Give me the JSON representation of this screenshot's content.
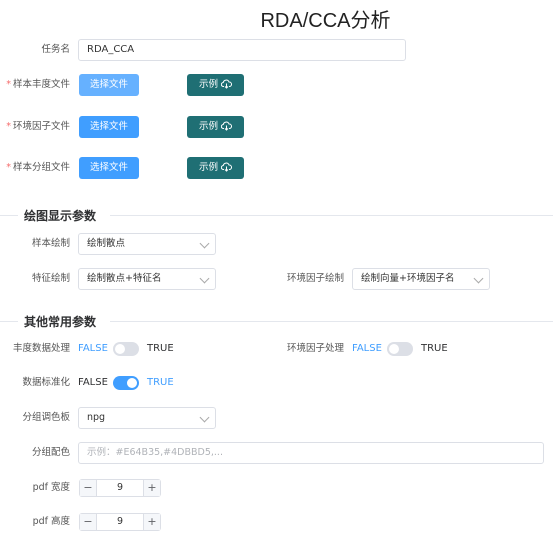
{
  "page": {
    "title": "RDA/CCA分析"
  },
  "task": {
    "label": "任务名",
    "value": "RDA_CCA"
  },
  "files": [
    {
      "label": "样本丰度文件",
      "button": "选择文件",
      "example": "示例"
    },
    {
      "label": "环境因子文件",
      "button": "选择文件",
      "example": "示例"
    },
    {
      "label": "样本分组文件",
      "button": "选择文件",
      "example": "示例"
    }
  ],
  "required_mark": "*",
  "plot_section": {
    "title": "绘图显示参数",
    "sample_plot": {
      "label": "样本绘制",
      "value": "绘制散点"
    },
    "feature_plot": {
      "label": "特征绘制",
      "value": "绘制散点+特征名"
    },
    "env_plot": {
      "label": "环境因子绘制",
      "value": "绘制向量+环境因子名"
    }
  },
  "other_section": {
    "title": "其他常用参数",
    "abundance_proc": {
      "label": "丰度数据处理",
      "off": "FALSE",
      "on": "TRUE",
      "state": false
    },
    "env_proc": {
      "label": "环境因子处理",
      "off": "FALSE",
      "on": "TRUE",
      "state": false
    },
    "standardize": {
      "label": "数据标准化",
      "off": "FALSE",
      "on": "TRUE",
      "state": true
    },
    "palette": {
      "label": "分组调色板",
      "value": "npg"
    },
    "group_colors": {
      "label": "分组配色",
      "placeholder": "示例：#E64B35,#4DBBD5,..."
    },
    "pdf_width": {
      "label": "pdf 宽度",
      "value": "9",
      "minus": "−",
      "plus": "+"
    },
    "pdf_height": {
      "label": "pdf 高度",
      "value": "9",
      "minus": "−",
      "plus": "+"
    }
  },
  "colors": {
    "primary": "#409eff",
    "teal": "#1f6f74",
    "required": "#f56c6c"
  }
}
